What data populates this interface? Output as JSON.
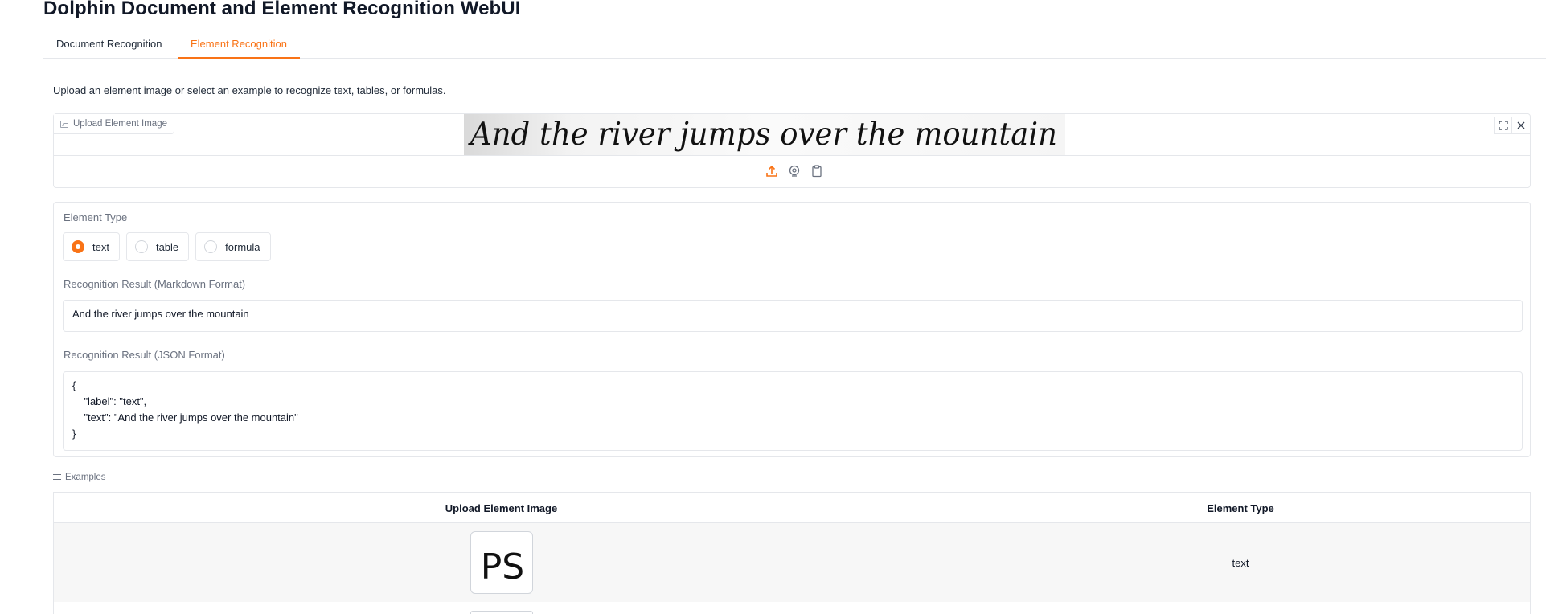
{
  "app": {
    "title": "Dolphin Document and Element Recognition WebUI"
  },
  "tabs": [
    {
      "label": "Document Recognition",
      "active": false
    },
    {
      "label": "Element Recognition",
      "active": true
    }
  ],
  "description": "Upload an element image or select an example to recognize text, tables, or formulas.",
  "upload": {
    "label": "Upload Element Image",
    "preview_text": "And the river jumps over the mountain",
    "icons": [
      "fullscreen-icon",
      "close-icon",
      "upload-icon",
      "webcam-icon",
      "clipboard-icon"
    ]
  },
  "element_type": {
    "label": "Element Type",
    "options": [
      "text",
      "table",
      "formula"
    ],
    "selected": "text"
  },
  "result_markdown": {
    "label": "Recognition Result (Markdown Format)",
    "value": "And the river jumps over the mountain"
  },
  "result_json": {
    "label": "Recognition Result (JSON Format)",
    "value": "{\n    \"label\": \"text\",\n    \"text\": \"And the river jumps over the mountain\"\n}"
  },
  "examples": {
    "label": "Examples",
    "headers": [
      "Upload Element Image",
      "Element Type"
    ],
    "rows": [
      {
        "image_text": "PS",
        "type": "text"
      },
      {
        "image_text": "",
        "type": ""
      }
    ]
  },
  "colors": {
    "accent": "#f97316",
    "border": "#e5e7eb",
    "label_gray": "#6b7280"
  }
}
